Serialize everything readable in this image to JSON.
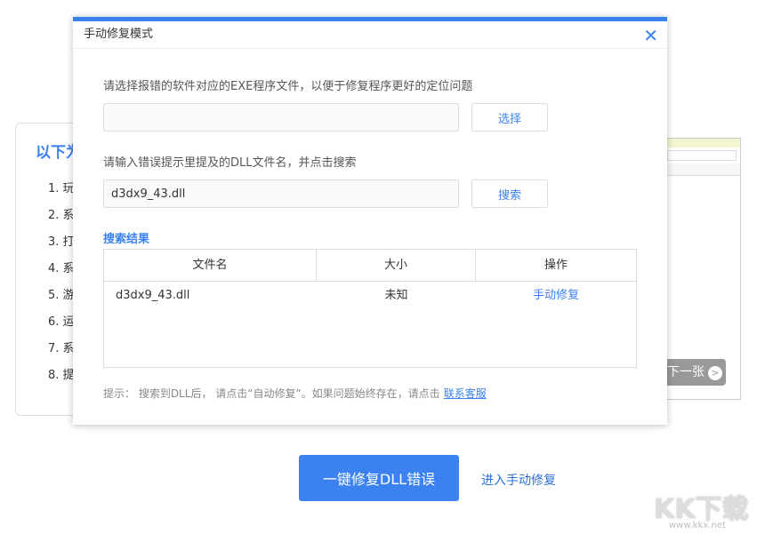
{
  "background": {
    "card_title": "以下为",
    "items": [
      "1. 玩",
      "2. 系",
      "3. 打",
      "4. 系",
      "5. 游",
      "6. 运",
      "7. 系",
      "8. 提"
    ],
    "screenshot": {
      "next_label": "下一张",
      "next_icon": "chevron-right-icon"
    }
  },
  "dialog": {
    "title": "手动修复模式",
    "exe_label": "请选择报错的软件对应的EXE程序文件，以便于修复程序更好的定位问题",
    "exe_value": "",
    "choose_button": "选择",
    "dll_label": "请输入错误提示里提及的DLL文件名，并点击搜索",
    "dll_value": "d3dx9_43.dll",
    "search_button": "搜索",
    "results_title": "搜索结果",
    "columns": [
      "文件名",
      "大小",
      "操作"
    ],
    "rows": [
      {
        "name": "d3dx9_43.dll",
        "size": "未知",
        "action": "手动修复"
      }
    ],
    "tip": "提示： 搜索到DLL后， 请点击“自动修复”。如果问题始终存在，请点击",
    "tip_link": "联系客服"
  },
  "main": {
    "fix_button": "一键修复DLL错误",
    "manual_link": "进入手动修复"
  },
  "watermark": {
    "logo": "KK下载",
    "url": "www.kkx.net"
  },
  "colors": {
    "accent": "#3b82f0"
  }
}
